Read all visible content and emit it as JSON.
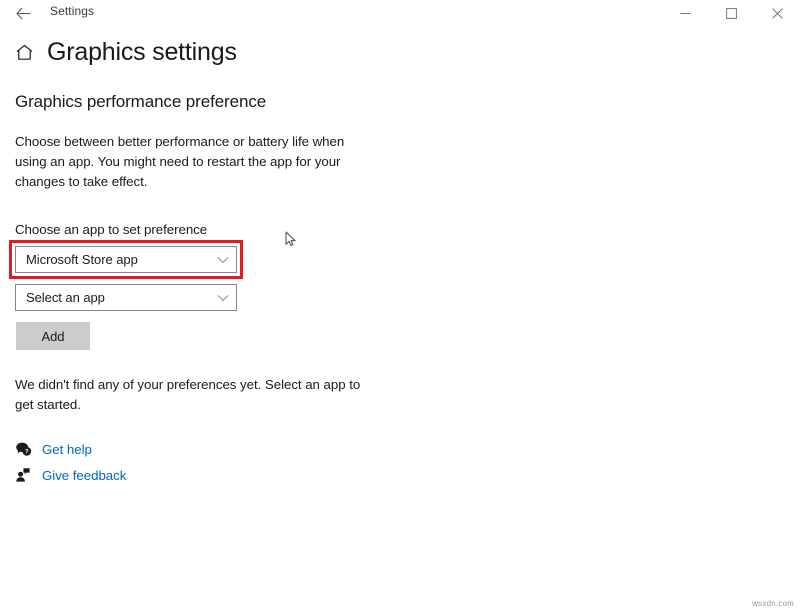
{
  "window": {
    "app_title": "Settings",
    "back_icon": "back-arrow-icon",
    "minimize_label": "─",
    "maximize_label": "□",
    "close_label": "✕"
  },
  "header": {
    "home_icon": "home-icon",
    "page_title": "Graphics settings"
  },
  "main": {
    "section_title": "Graphics performance preference",
    "description": "Choose between better performance or battery life when using an app. You might need to restart the app for your changes to take effect.",
    "field_label": "Choose an app to set preference",
    "app_type_dropdown": {
      "value": "Microsoft Store app",
      "chevron_icon": "chevron-down-icon",
      "highlighted": true,
      "highlight_color": "#e01b22"
    },
    "app_select_dropdown": {
      "value": "Select an app",
      "chevron_icon": "chevron-down-icon"
    },
    "add_button": "Add",
    "status_text": "We didn't find any of your preferences yet. Select an app to get started."
  },
  "footer": {
    "links": [
      {
        "label": "Get help",
        "icon": "help-bubble-icon"
      },
      {
        "label": "Give feedback",
        "icon": "feedback-person-icon"
      }
    ],
    "link_color": "#0067c0"
  },
  "overlay": {
    "cursor_icon": "arrow-cursor",
    "watermark": "wsxdn.com"
  }
}
